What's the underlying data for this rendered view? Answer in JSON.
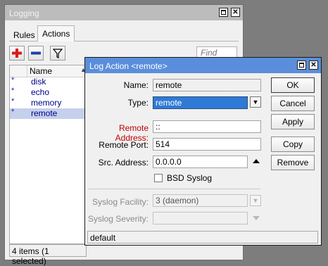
{
  "logging_window": {
    "title": "Logging",
    "tabs": [
      {
        "label": "Rules"
      },
      {
        "label": "Actions"
      }
    ],
    "find_placeholder": "Find",
    "columns": {
      "name": "Name"
    },
    "items": [
      {
        "marker": "*",
        "name": "disk"
      },
      {
        "marker": "*",
        "name": "echo"
      },
      {
        "marker": "*",
        "name": "memory"
      },
      {
        "marker": "*",
        "name": "remote"
      }
    ],
    "selected_item": "remote",
    "status": "4 items (1 selected)",
    "icons": [
      "add-icon",
      "remove-icon",
      "filter-icon"
    ]
  },
  "dialog": {
    "title": "Log Action <remote>",
    "name_label": "Name:",
    "name_value": "remote",
    "type_label": "Type:",
    "type_value": "remote",
    "remote_address_label": "Remote Address:",
    "remote_address_value": "::",
    "remote_port_label": "Remote Port:",
    "remote_port_value": "514",
    "src_address_label": "Src. Address:",
    "src_address_value": "0.0.0.0",
    "bsd_syslog_label": "BSD Syslog",
    "bsd_syslog_checked": false,
    "syslog_facility_label": "Syslog Facility:",
    "syslog_facility_value": "3 (daemon)",
    "syslog_severity_label": "Syslog Severity:",
    "syslog_severity_value": "",
    "buttons": {
      "ok": "OK",
      "cancel": "Cancel",
      "apply": "Apply",
      "copy": "Copy",
      "remove": "Remove"
    },
    "status": "default"
  },
  "colors": {
    "active_title": "#5a8edc",
    "inactive_title": "#bcbcbc",
    "required_label": "#c00000",
    "selection": "#c4d0ec",
    "add_icon": "#d81b1b",
    "remove_icon": "#1f3fa8"
  }
}
